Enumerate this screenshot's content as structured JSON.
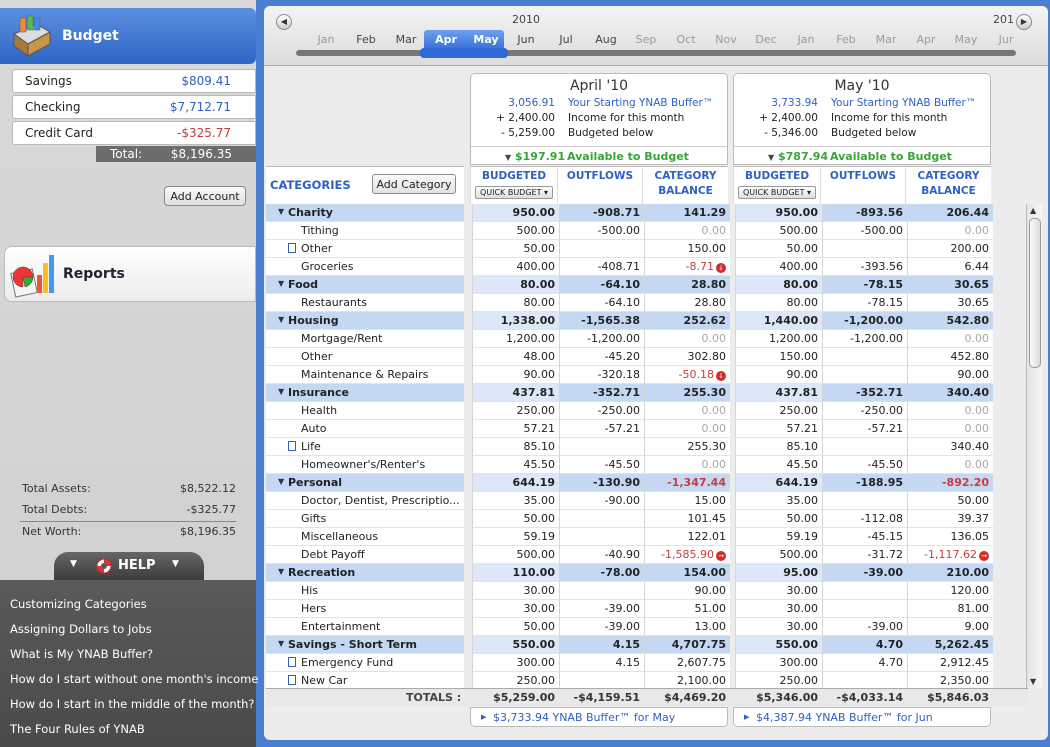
{
  "sidebar": {
    "budget_title": "Budget",
    "reports_title": "Reports",
    "accounts": [
      {
        "name": "Savings",
        "value": "$809.41",
        "neg": false
      },
      {
        "name": "Checking",
        "value": "$7,712.71",
        "neg": false
      },
      {
        "name": "Credit Card",
        "value": "-$325.77",
        "neg": true
      }
    ],
    "total_label": "Total:",
    "total_value": "$8,196.35",
    "add_account": "Add Account",
    "summary": [
      {
        "label": "Total Assets:",
        "value": "$8,522.12"
      },
      {
        "label": "Total Debts:",
        "value": "-$325.77"
      },
      {
        "label": "Net Worth:",
        "value": "$8,196.35"
      }
    ],
    "help_label": "HELP",
    "help_links": [
      "Customizing Categories",
      "Assigning Dollars to Jobs",
      "What is My YNAB Buffer?",
      "How do I start without one month's income",
      "How do I start in the middle of the month?",
      "The Four Rules of YNAB"
    ]
  },
  "timeline": {
    "year_left": "2010",
    "year_right": "201",
    "months": [
      "Jan",
      "Feb",
      "Mar",
      "Apr",
      "May",
      "Jun",
      "Jul",
      "Aug",
      "Sep",
      "Oct",
      "Nov",
      "Dec",
      "Jan",
      "Feb",
      "Mar",
      "Apr",
      "May",
      "Jur"
    ],
    "dark_months": [
      1,
      2,
      3,
      4,
      5,
      6,
      7
    ]
  },
  "months": [
    {
      "title": "April '10",
      "buffer_value": "3,056.91",
      "buffer_label": "Your Starting YNAB Buffer™",
      "income_value": "+ 2,400.00",
      "income_label": "Income for this month",
      "budgeted_value": "- 5,259.00",
      "budgeted_label": "Budgeted below",
      "available_value": "$197.91",
      "available_label": "Available to Budget",
      "footer": "$3,733.94 YNAB Buffer™ for May"
    },
    {
      "title": "May '10",
      "buffer_value": "3,733.94",
      "buffer_label": "Your Starting YNAB Buffer™",
      "income_value": "+ 2,400.00",
      "income_label": "Income for this month",
      "budgeted_value": "- 5,346.00",
      "budgeted_label": "Budgeted below",
      "available_value": "$787.94",
      "available_label": "Available to Budget",
      "footer": "$4,387.94 YNAB Buffer™ for Jun"
    }
  ],
  "table_head": {
    "categories": "CATEGORIES",
    "add_category": "Add Category",
    "budgeted": "BUDGETED",
    "outflows": "OUTFLOWS",
    "balance_1": "CATEGORY",
    "balance_2": "BALANCE",
    "quick_budget": "QUICK BUDGET ▾"
  },
  "rows": [
    {
      "g": true,
      "name": "Charity",
      "a": [
        "950.00",
        "-908.71",
        "141.29"
      ],
      "m": [
        "950.00",
        "-893.56",
        "206.44"
      ]
    },
    {
      "g": false,
      "name": "Tithing",
      "a": [
        "500.00",
        "-500.00",
        "0.00"
      ],
      "m": [
        "500.00",
        "-500.00",
        "0.00"
      ]
    },
    {
      "g": false,
      "name": "Other",
      "doc": true,
      "a": [
        "50.00",
        "",
        "150.00"
      ],
      "m": [
        "50.00",
        "",
        "200.00"
      ]
    },
    {
      "g": false,
      "name": "Groceries",
      "a": [
        "400.00",
        "-408.71",
        "-8.71"
      ],
      "m": [
        "400.00",
        "-393.56",
        "6.44"
      ],
      "warn_a": "↓"
    },
    {
      "g": true,
      "name": "Food",
      "a": [
        "80.00",
        "-64.10",
        "28.80"
      ],
      "m": [
        "80.00",
        "-78.15",
        "30.65"
      ]
    },
    {
      "g": false,
      "name": "Restaurants",
      "a": [
        "80.00",
        "-64.10",
        "28.80"
      ],
      "m": [
        "80.00",
        "-78.15",
        "30.65"
      ]
    },
    {
      "g": true,
      "name": "Housing",
      "a": [
        "1,338.00",
        "-1,565.38",
        "252.62"
      ],
      "m": [
        "1,440.00",
        "-1,200.00",
        "542.80"
      ]
    },
    {
      "g": false,
      "name": "Mortgage/Rent",
      "a": [
        "1,200.00",
        "-1,200.00",
        "0.00"
      ],
      "m": [
        "1,200.00",
        "-1,200.00",
        "0.00"
      ]
    },
    {
      "g": false,
      "name": "Other",
      "a": [
        "48.00",
        "-45.20",
        "302.80"
      ],
      "m": [
        "150.00",
        "",
        "452.80"
      ]
    },
    {
      "g": false,
      "name": "Maintenance & Repairs",
      "a": [
        "90.00",
        "-320.18",
        "-50.18"
      ],
      "m": [
        "90.00",
        "",
        "90.00"
      ],
      "warn_a": "↓"
    },
    {
      "g": true,
      "name": "Insurance",
      "a": [
        "437.81",
        "-352.71",
        "255.30"
      ],
      "m": [
        "437.81",
        "-352.71",
        "340.40"
      ]
    },
    {
      "g": false,
      "name": "Health",
      "a": [
        "250.00",
        "-250.00",
        "0.00"
      ],
      "m": [
        "250.00",
        "-250.00",
        "0.00"
      ]
    },
    {
      "g": false,
      "name": "Auto",
      "a": [
        "57.21",
        "-57.21",
        "0.00"
      ],
      "m": [
        "57.21",
        "-57.21",
        "0.00"
      ]
    },
    {
      "g": false,
      "name": "Life",
      "doc": true,
      "a": [
        "85.10",
        "",
        "255.30"
      ],
      "m": [
        "85.10",
        "",
        "340.40"
      ]
    },
    {
      "g": false,
      "name": "Homeowner's/Renter's",
      "a": [
        "45.50",
        "-45.50",
        "0.00"
      ],
      "m": [
        "45.50",
        "-45.50",
        "0.00"
      ]
    },
    {
      "g": true,
      "name": "Personal",
      "a": [
        "644.19",
        "-130.90",
        "-1,347.44"
      ],
      "m": [
        "644.19",
        "-188.95",
        "-892.20"
      ]
    },
    {
      "g": false,
      "name": "Doctor, Dentist, Prescriptio...",
      "a": [
        "35.00",
        "-90.00",
        "15.00"
      ],
      "m": [
        "35.00",
        "",
        "50.00"
      ]
    },
    {
      "g": false,
      "name": "Gifts",
      "a": [
        "50.00",
        "",
        "101.45"
      ],
      "m": [
        "50.00",
        "-112.08",
        "39.37"
      ]
    },
    {
      "g": false,
      "name": "Miscellaneous",
      "a": [
        "59.19",
        "",
        "122.01"
      ],
      "m": [
        "59.19",
        "-45.15",
        "136.05"
      ]
    },
    {
      "g": false,
      "name": "Debt Payoff",
      "a": [
        "500.00",
        "-40.90",
        "-1,585.90"
      ],
      "m": [
        "500.00",
        "-31.72",
        "-1,117.62"
      ],
      "warn_a": "→",
      "warn_m": "→"
    },
    {
      "g": true,
      "name": "Recreation",
      "a": [
        "110.00",
        "-78.00",
        "154.00"
      ],
      "m": [
        "95.00",
        "-39.00",
        "210.00"
      ]
    },
    {
      "g": false,
      "name": "His",
      "a": [
        "30.00",
        "",
        "90.00"
      ],
      "m": [
        "30.00",
        "",
        "120.00"
      ]
    },
    {
      "g": false,
      "name": "Hers",
      "a": [
        "30.00",
        "-39.00",
        "51.00"
      ],
      "m": [
        "30.00",
        "",
        "81.00"
      ]
    },
    {
      "g": false,
      "name": "Entertainment",
      "a": [
        "50.00",
        "-39.00",
        "13.00"
      ],
      "m": [
        "30.00",
        "-39.00",
        "9.00"
      ]
    },
    {
      "g": true,
      "name": "Savings - Short Term",
      "a": [
        "550.00",
        "4.15",
        "4,707.75"
      ],
      "m": [
        "550.00",
        "4.70",
        "5,262.45"
      ]
    },
    {
      "g": false,
      "name": "Emergency Fund",
      "doc": true,
      "a": [
        "300.00",
        "4.15",
        "2,607.75"
      ],
      "m": [
        "300.00",
        "4.70",
        "2,912.45"
      ]
    },
    {
      "g": false,
      "name": "New Car",
      "doc": true,
      "a": [
        "250.00",
        "",
        "2,100.00"
      ],
      "m": [
        "250.00",
        "",
        "2,350.00"
      ]
    }
  ],
  "totals": {
    "label": "TOTALS :",
    "a": [
      "$5,259.00",
      "-$4,159.51",
      "$4,469.20"
    ],
    "m": [
      "$5,346.00",
      "-$4,033.14",
      "$5,846.03"
    ]
  },
  "colors": {
    "accent": "#2d61c4",
    "group_row": "#c4d8f4",
    "negative": "#c43d3d",
    "positive": "#3aa33a"
  }
}
